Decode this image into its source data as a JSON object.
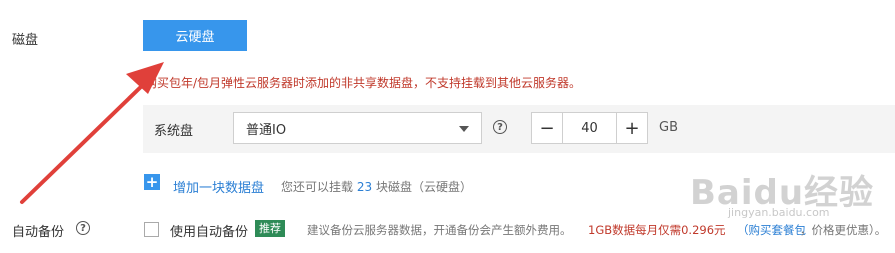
{
  "disk": {
    "label": "磁盘",
    "type_button": "云硬盘",
    "notice": "购买包年/包月弹性云服务器时添加的非共享数据盘，不支持挂载到其他云服务器。"
  },
  "system_disk": {
    "label": "系统盘",
    "type_value": "普通IO",
    "size_value": "40",
    "unit": "GB",
    "minus": "−",
    "plus": "+"
  },
  "add_disk": {
    "icon_text": "+",
    "link": "增加一块数据盘",
    "info_prefix": "您还可以挂载",
    "info_count": "23",
    "info_suffix": "块磁盘（云硬盘）"
  },
  "backup": {
    "label": "自动备份",
    "checkbox_text": "使用自动备份",
    "badge": "推荐",
    "desc": "建议备份云服务器数据，开通备份会产生额外费用。",
    "price": "1GB数据每月仅需0.296元",
    "buy_link": "（购买套餐包",
    "buy_tail": "，价格更优惠）。"
  },
  "watermark": {
    "text": "Baidu经验",
    "url": "jingyan.baidu.com"
  },
  "colors": {
    "accent": "#3796ec",
    "warning": "#c0392b",
    "badge": "#2e8b57",
    "arrow": "#e0403a"
  }
}
